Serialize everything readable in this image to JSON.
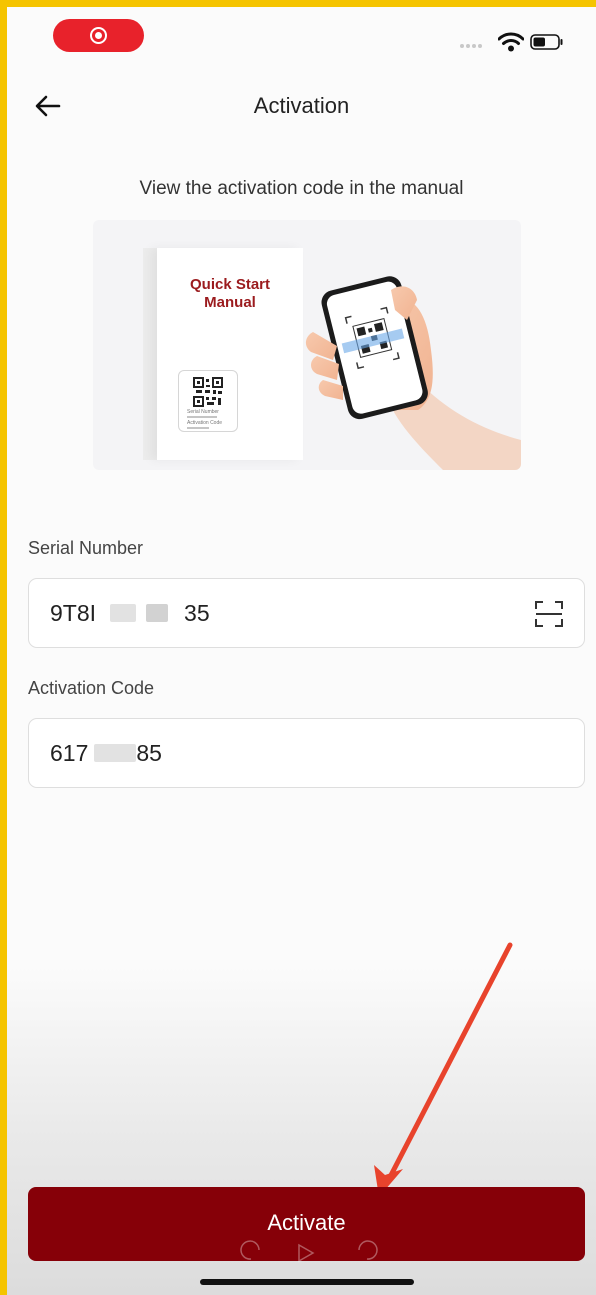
{
  "status_bar": {
    "recording_icon": "record-icon",
    "wifi_icon": "wifi-icon",
    "battery_icon": "battery-icon",
    "battery_level": 0.5
  },
  "header": {
    "back_icon": "arrow-left-icon",
    "title": "Activation"
  },
  "instruction": "View the activation code in the manual",
  "illustration": {
    "manual_title_line1": "Quick Start",
    "manual_title_line2": "Manual",
    "card_serial_label": "Serial Number",
    "card_code_label": "Activation Code"
  },
  "form": {
    "serial": {
      "label": "Serial Number",
      "value_prefix": "9T8I",
      "value_suffix": "35",
      "scan_icon": "scan-icon"
    },
    "activation_code": {
      "label": "Activation Code",
      "value_prefix": "617",
      "value_suffix": "85"
    }
  },
  "activate_button": "Activate",
  "colors": {
    "frame": "#f5c400",
    "primary": "#860008",
    "arrow": "#e8432c"
  }
}
